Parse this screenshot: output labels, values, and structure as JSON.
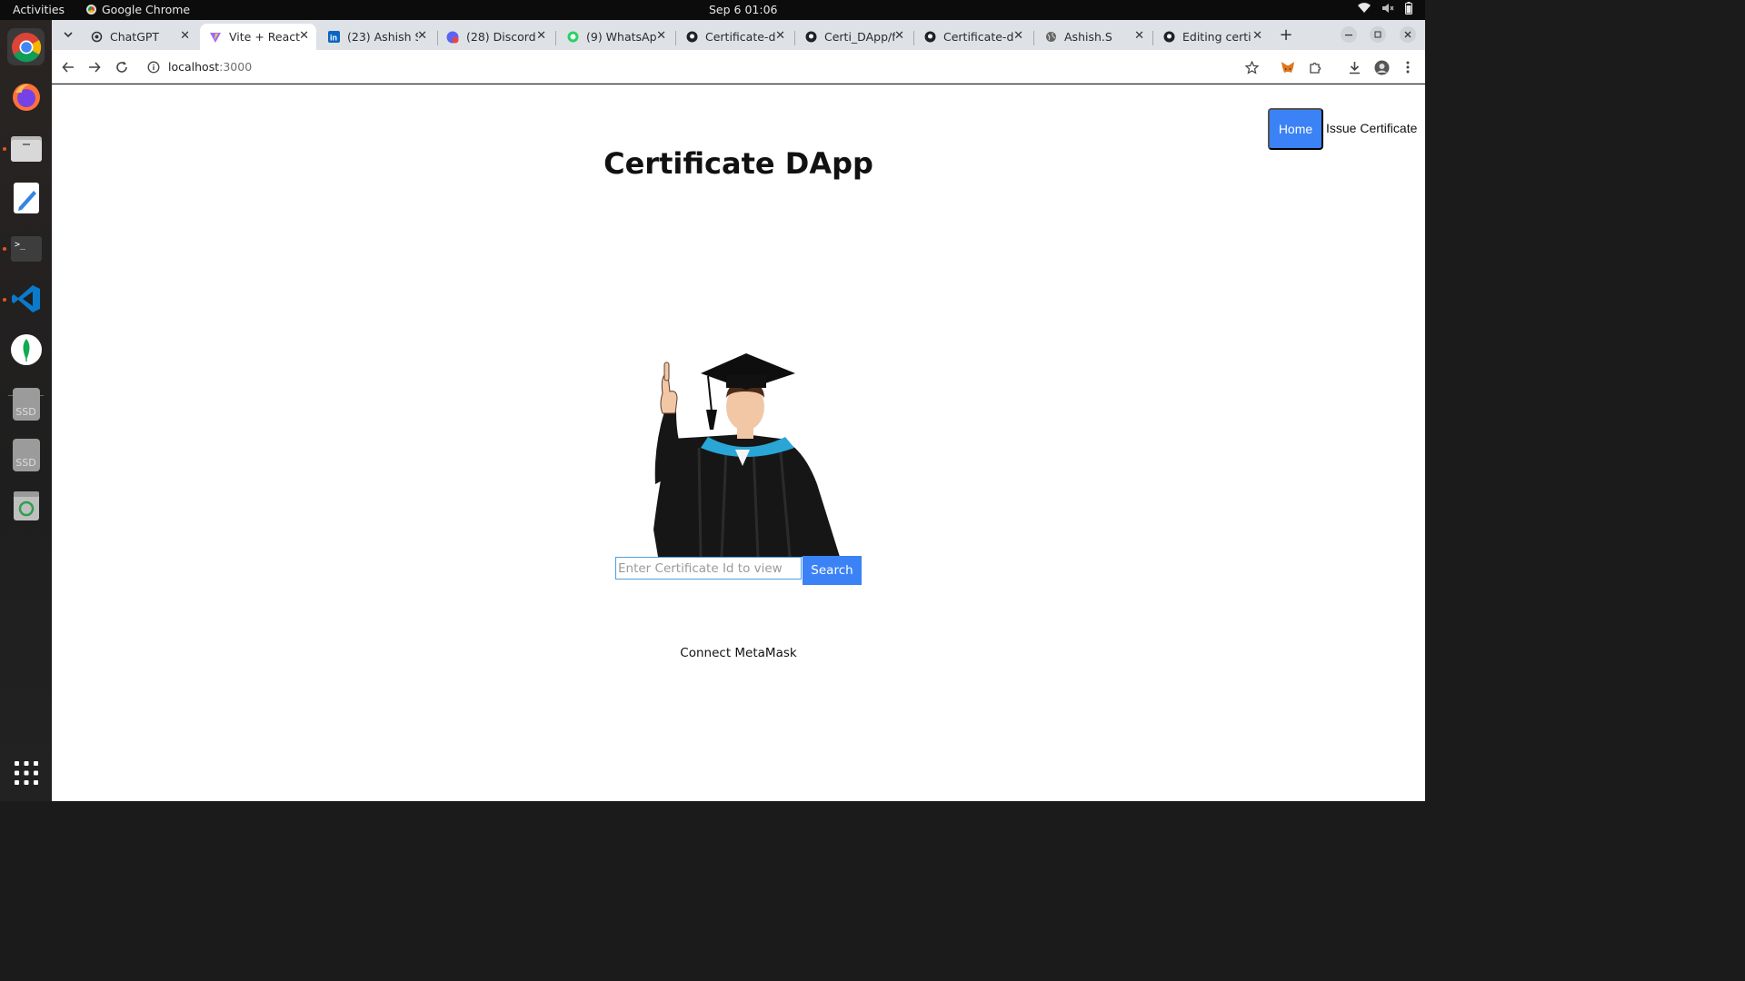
{
  "system": {
    "activities": "Activities",
    "app_name": "Google Chrome",
    "clock": "Sep 6  01:06"
  },
  "tabs": [
    {
      "label": "ChatGPT",
      "icon": "openai-icon"
    },
    {
      "label": "Vite + React",
      "icon": "vite-icon"
    },
    {
      "label": "(23) Ashish S",
      "icon": "linkedin-icon"
    },
    {
      "label": "(28) Discord |",
      "icon": "discord-icon"
    },
    {
      "label": "(9) WhatsApp",
      "icon": "whatsapp-icon"
    },
    {
      "label": "Certificate-d",
      "icon": "github-icon"
    },
    {
      "label": "Certi_DApp/f",
      "icon": "github-icon"
    },
    {
      "label": "Certificate-d",
      "icon": "github-icon"
    },
    {
      "label": "Ashish.S",
      "icon": "globe-icon"
    },
    {
      "label": "Editing certi",
      "icon": "github-icon"
    }
  ],
  "toolbar": {
    "url_host": "localhost",
    "url_port": ":3000"
  },
  "page": {
    "nav_home": "Home",
    "nav_issue": "Issue Certificate",
    "title": "Certificate DApp",
    "search_placeholder": "Enter Certificate Id to view",
    "search_button": "Search",
    "connect": "Connect MetaMask"
  },
  "dock": {
    "ssd1": "SSD",
    "ssd2": "SSD"
  },
  "colors": {
    "accent": "#3b82f6",
    "ubuntu_orange": "#e95420"
  }
}
